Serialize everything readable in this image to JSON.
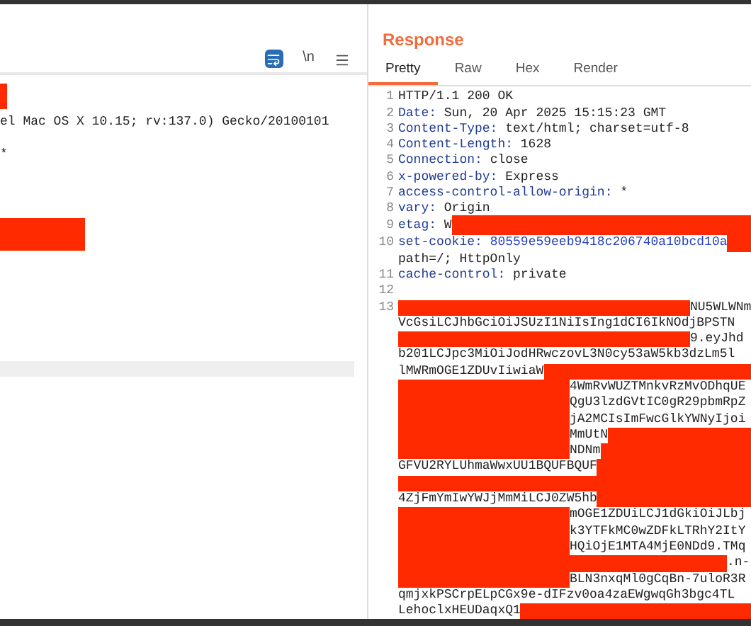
{
  "request": {
    "toolbar": {
      "wrap_selected": true,
      "newline_label": "\\n",
      "newline_selected": false
    },
    "lines": [
      {
        "kind": "redacted"
      },
      {
        "kind": "text",
        "text": "el Mac OS X 10.15; rv:137.0) Gecko/20100101"
      },
      {
        "kind": "text",
        "text": "*"
      },
      {
        "kind": "redacted"
      },
      {
        "kind": "highlight"
      }
    ]
  },
  "response": {
    "title": "Response",
    "tabs": [
      {
        "label": "Pretty",
        "selected": true
      },
      {
        "label": "Raw",
        "selected": false
      },
      {
        "label": "Hex",
        "selected": false
      },
      {
        "label": "Render",
        "selected": false
      }
    ],
    "headers": [
      {
        "number": "1",
        "status": "HTTP/1.1 200 OK"
      },
      {
        "number": "2",
        "name": "Date:",
        "value": "Sun, 20 Apr 2025 15:15:23 GMT"
      },
      {
        "number": "3",
        "name": "Content-Type:",
        "value": "text/html; charset=utf-8"
      },
      {
        "number": "4",
        "name": "Content-Length:",
        "value": "1628"
      },
      {
        "number": "5",
        "name": "Connection:",
        "value": "close"
      },
      {
        "number": "6",
        "name": "x-powered-by:",
        "value": "Express"
      },
      {
        "number": "7",
        "name": "access-control-allow-origin:",
        "value": "*"
      },
      {
        "number": "8",
        "name": "vary:",
        "value": "Origin"
      },
      {
        "number": "9",
        "name": "etag:",
        "value": "W",
        "redacted": true
      },
      {
        "number": "10",
        "name": "set-cookie:",
        "value": "80559e59eeb9418c206740a10bcd10a",
        "redacted": true,
        "continuation": "path=/; HttpOnly"
      },
      {
        "number": "11",
        "name": "cache-control:",
        "value": "private"
      },
      {
        "number": "12"
      }
    ],
    "body_number": "13",
    "body": [
      [
        {
          "kind": "redacted"
        },
        {
          "kind": "text",
          "text": "NU5WLWNm"
        }
      ],
      [
        {
          "kind": "text",
          "text": "VcGsiLCJhbGciOiJSUzI1NiIsIng1dCI6IkNOdjBPSTN"
        }
      ],
      [
        {
          "kind": "redacted"
        },
        {
          "kind": "text",
          "text": "9.eyJhd"
        }
      ],
      [
        {
          "kind": "text",
          "text": "b201LCJpc3MiOiJodHRwczovL3N0cy53aW5kb3dzLm5l"
        }
      ],
      [
        {
          "kind": "text",
          "text": "lMWRmOGE1ZDUvIiwiaW"
        },
        {
          "kind": "redacted"
        }
      ],
      [
        {
          "kind": "redacted"
        },
        {
          "kind": "text",
          "text": "4WmRvWUZTMnkvRzMvODhqUE"
        }
      ],
      [
        {
          "kind": "redacted"
        },
        {
          "kind": "text",
          "text": "QgU3lzdGVtIC0gR29pbmRpZ"
        }
      ],
      [
        {
          "kind": "redacted"
        },
        {
          "kind": "text",
          "text": "jA2MCIsImFwcGlkYWNyIjoi"
        }
      ],
      [
        {
          "kind": "redacted"
        },
        {
          "kind": "text",
          "text": "MmUtN"
        },
        {
          "kind": "redacted"
        }
      ],
      [
        {
          "kind": "redacted"
        },
        {
          "kind": "text",
          "text": "NDNm"
        },
        {
          "kind": "redacted"
        }
      ],
      [
        {
          "kind": "text",
          "text": "GFVU2RYLUhmaWwxUU1BQUFBQUF"
        },
        {
          "kind": "redacted"
        }
      ],
      [
        {
          "kind": "redacted"
        }
      ],
      [
        {
          "kind": "text",
          "text": "4ZjFmYmIwYWJjMmMiLCJ0ZW5hb"
        },
        {
          "kind": "redacted"
        }
      ],
      [
        {
          "kind": "redacted"
        },
        {
          "kind": "text",
          "text": "mOGE1ZDUiLCJ1dGkiOiJLbj"
        }
      ],
      [
        {
          "kind": "redacted"
        },
        {
          "kind": "text",
          "text": "k3YTFkMC0wZDFkLTRhY2ItY"
        }
      ],
      [
        {
          "kind": "redacted"
        },
        {
          "kind": "text",
          "text": "HQiOjE1MTA4MjE0NDd9.TMq"
        }
      ],
      [
        {
          "kind": "redacted"
        },
        {
          "kind": "text",
          "text": ".n-"
        }
      ],
      [
        {
          "kind": "redacted"
        },
        {
          "kind": "text",
          "text": "BLN3nxqMl0gCqBn-7uloR3R"
        }
      ],
      [
        {
          "kind": "text",
          "text": "qmjxkPSCrpELpCGx9e-dIFzv0oa4zaEWgwqGh3bgc4TL"
        }
      ],
      [
        {
          "kind": "text",
          "text": "LehoclxHEUDaqxQ1"
        },
        {
          "kind": "redacted"
        }
      ]
    ]
  }
}
